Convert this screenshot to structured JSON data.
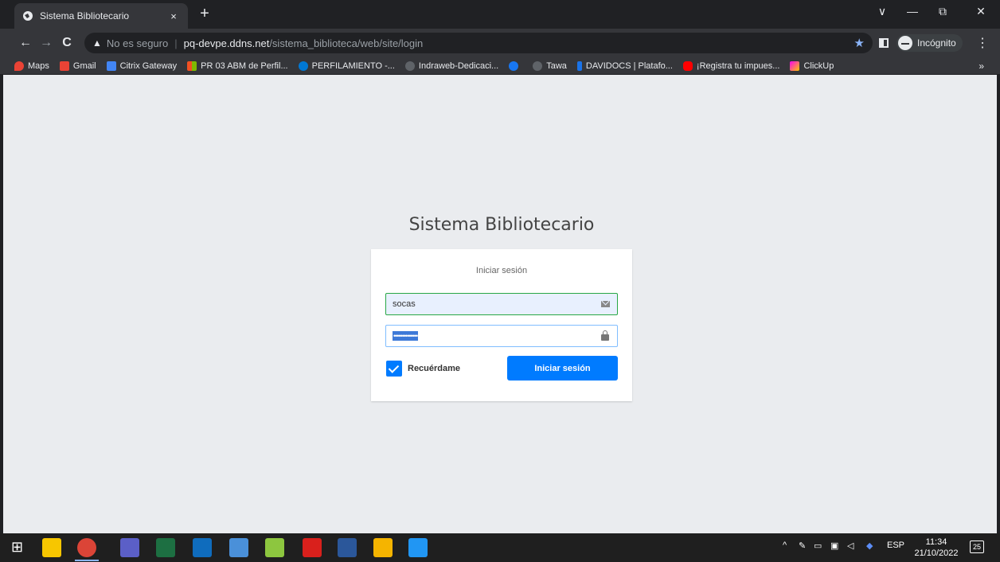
{
  "browser": {
    "tab_title": "Sistema Bibliotecario",
    "tab_close": "×",
    "new_tab": "+",
    "window_controls": [
      "∨",
      "—",
      "⧉",
      "✕"
    ],
    "back": "←",
    "forward": "→",
    "reload": "C",
    "warning_icon": "▲",
    "insecure_label": "No es seguro",
    "separator": "|",
    "url_host": "pq-devpe.ddns.net",
    "url_path": "/sistema_biblioteca/web/site/login",
    "star": "★",
    "incognito_label": "Incógnito",
    "menu": "⋮"
  },
  "bookmarks": [
    {
      "label": "Maps",
      "color": "#ea4335"
    },
    {
      "label": "Gmail",
      "color": "#ea4335"
    },
    {
      "label": "Citrix Gateway",
      "color": "#4285f4"
    },
    {
      "label": "PR 03 ABM de Perfil...",
      "color": "#f25022"
    },
    {
      "label": "PERFILAMIENTO -...",
      "color": "#0078d4"
    },
    {
      "label": "Indraweb-Dedicaci...",
      "color": "#5f6368"
    },
    {
      "label": "",
      "color": "#1877f2"
    },
    {
      "label": "Tawa",
      "color": "#5f6368"
    },
    {
      "label": "DAVIDOCS | Platafo...",
      "color": "#1a73e8"
    },
    {
      "label": "¡Registra tu impues...",
      "color": "#ff0000"
    },
    {
      "label": "ClickUp",
      "color": "#e8eaed"
    }
  ],
  "bookmarks_more": "»",
  "page": {
    "title": "Sistema Bibliotecario",
    "box_message": "Iniciar sesión",
    "username_value": "socas",
    "password_mask": "••••••••••••••",
    "remember_label": "Recuérdame",
    "login_button": "Iniciar sesión"
  },
  "taskbar": {
    "windows_icon": "⊞",
    "tray_up": "^",
    "language": "ESP",
    "time": "11:34",
    "date": "21/10/2022",
    "notifications": "25"
  },
  "colors": {
    "accent": "#007bff",
    "page_bg": "#eaecef",
    "valid_border": "#28a745"
  }
}
